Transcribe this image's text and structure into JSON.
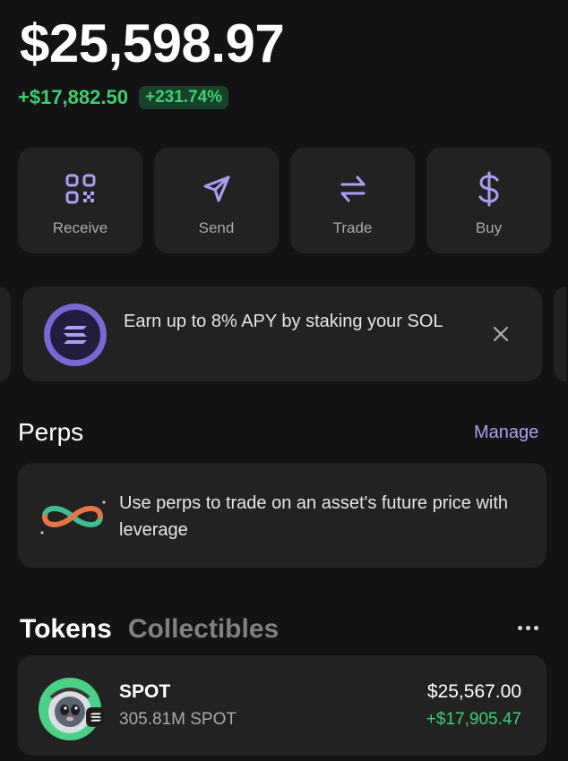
{
  "portfolio": {
    "balance": "$25,598.97",
    "change_amount": "+$17,882.50",
    "change_percent": "+231.74%"
  },
  "actions": [
    {
      "label": "Receive",
      "icon": "qr-code-icon"
    },
    {
      "label": "Send",
      "icon": "send-icon"
    },
    {
      "label": "Trade",
      "icon": "swap-icon"
    },
    {
      "label": "Buy",
      "icon": "dollar-icon"
    }
  ],
  "promo": {
    "text": "Earn up to 8% APY by staking your SOL",
    "icon": "solana-logo-icon"
  },
  "perps": {
    "title": "Perps",
    "manage_label": "Manage",
    "card_text": "Use perps to trade on an asset's future price with leverage"
  },
  "assets": {
    "tabs": [
      "Tokens",
      "Collectibles"
    ],
    "active_tab": "Tokens"
  },
  "tokens": [
    {
      "name": "SPOT",
      "amount": "305.81M SPOT",
      "value": "$25,567.00",
      "pnl": "+$17,905.47"
    }
  ],
  "colors": {
    "background": "#131313",
    "card": "#222222",
    "accent": "#ab9ff2",
    "positive": "#3fcf72"
  }
}
